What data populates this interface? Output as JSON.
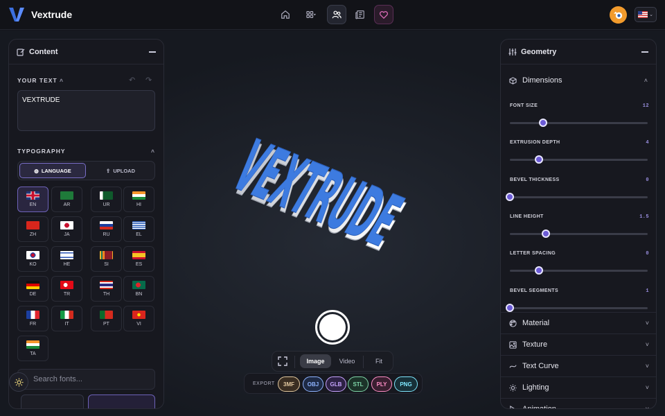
{
  "app": {
    "title": "Vextrude",
    "accent": "#6c5bd6"
  },
  "nav": [
    {
      "name": "nav-home-button",
      "icon": "home-icon"
    },
    {
      "name": "nav-apps-button",
      "icon": "grid-icon"
    },
    {
      "name": "nav-community-button",
      "icon": "users-icon",
      "active": true
    },
    {
      "name": "nav-news-button",
      "icon": "newspaper-icon"
    },
    {
      "name": "nav-favorites-button",
      "icon": "heart-icon"
    }
  ],
  "left": {
    "header": "Content",
    "your_text_label": "YOUR TEXT",
    "text_value": "VEXTRUDE",
    "typography_label": "TYPOGRAPHY",
    "tab_language": "LANGUAGE",
    "tab_upload": "UPLOAD",
    "languages": [
      "EN",
      "AR",
      "UR",
      "HI",
      "ZH",
      "JA",
      "RU",
      "EL",
      "KO",
      "HE",
      "SI",
      "ES",
      "DE",
      "TR",
      "TH",
      "BN",
      "FR",
      "IT",
      "PT",
      "VI",
      "TA"
    ],
    "selected_language": "EN",
    "search_placeholder": "Search fonts..."
  },
  "right": {
    "header": "Geometry",
    "dimensions_label": "Dimensions",
    "sliders": [
      {
        "label": "FONT SIZE",
        "value": "12",
        "fraction": 0.24
      },
      {
        "label": "EXTRUSION DEPTH",
        "value": "4",
        "fraction": 0.21
      },
      {
        "label": "BEVEL THICKNESS",
        "value": "0",
        "fraction": 0.0
      },
      {
        "label": "LINE HEIGHT",
        "value": "1.5",
        "fraction": 0.26
      },
      {
        "label": "LETTER SPACING",
        "value": "0",
        "fraction": 0.21
      },
      {
        "label": "BEVEL SEGMENTS",
        "value": "1",
        "fraction": 0.0
      }
    ],
    "accordions": [
      "Material",
      "Texture",
      "Text Curve",
      "Lighting",
      "Animation"
    ]
  },
  "viewport": {
    "model_text": "VEXTRUDE",
    "modes": [
      "Image",
      "Video",
      "Fit"
    ],
    "active_mode": "Image",
    "export_label": "EXPORT",
    "formats": [
      {
        "label": "3MF",
        "color": "#e3c9a0",
        "bg": "#3a2e22"
      },
      {
        "label": "OBJ",
        "color": "#8fb4ff",
        "bg": "#1e2a45"
      },
      {
        "label": "GLB",
        "color": "#c7a4ff",
        "bg": "#2e2245"
      },
      {
        "label": "STL",
        "color": "#7fd6a8",
        "bg": "#1c3329"
      },
      {
        "label": "PLY",
        "color": "#ff8fc7",
        "bg": "#3a1f30"
      },
      {
        "label": "PNG",
        "color": "#7fe8ff",
        "bg": "#173038"
      }
    ]
  }
}
